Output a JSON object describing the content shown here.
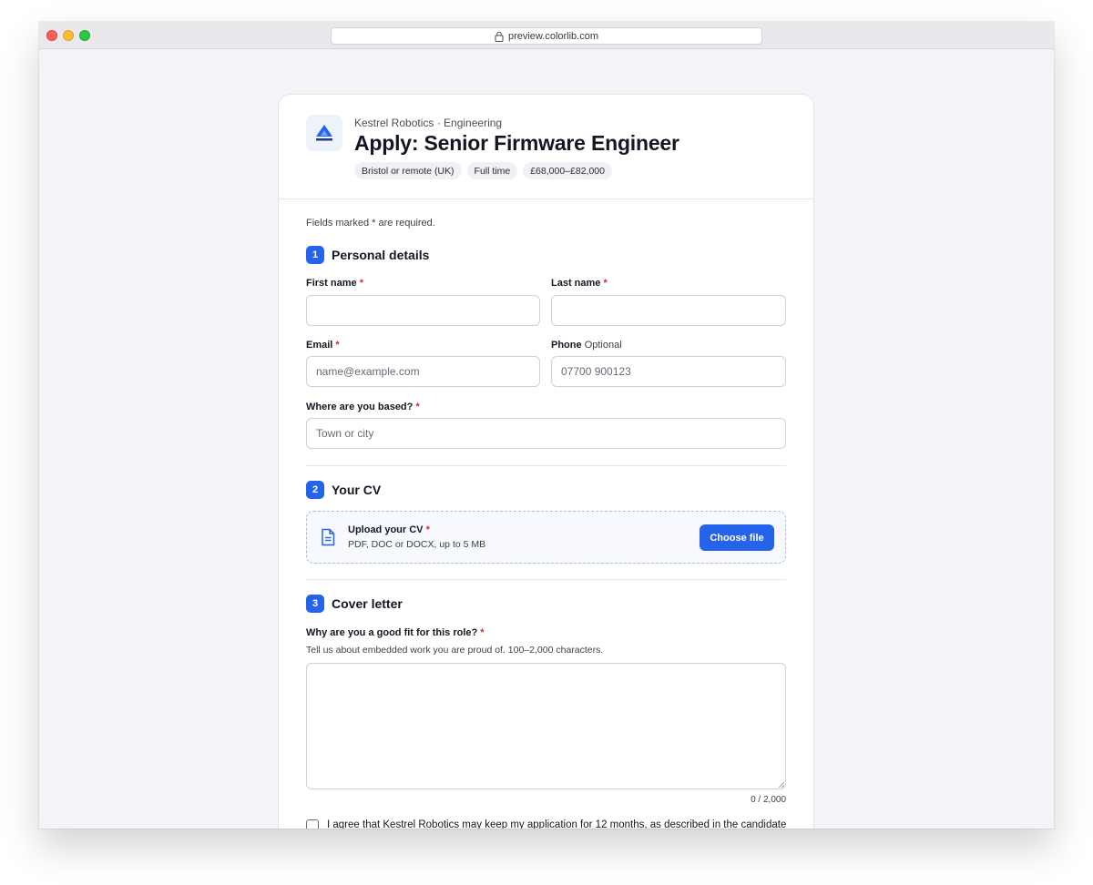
{
  "browser": {
    "url": "preview.colorlib.com"
  },
  "header": {
    "company": "Kestrel Robotics · Engineering",
    "title": "Apply: Senior Firmware Engineer",
    "tags": [
      "Bristol or remote (UK)",
      "Full time",
      "£68,000–£82,000"
    ]
  },
  "form": {
    "required_note": "Fields marked * are required.",
    "sections": [
      {
        "number": "1",
        "title": "Personal details"
      },
      {
        "number": "2",
        "title": "Your CV"
      },
      {
        "number": "3",
        "title": "Cover letter"
      }
    ],
    "first_name": {
      "label": "First name",
      "required_mark": "*",
      "value": ""
    },
    "last_name": {
      "label": "Last name",
      "required_mark": "*",
      "value": ""
    },
    "email": {
      "label": "Email",
      "required_mark": "*",
      "placeholder": "name@example.com"
    },
    "phone": {
      "label": "Phone",
      "optional": "Optional",
      "placeholder": "07700 900123"
    },
    "location": {
      "label": "Where are you based?",
      "required_mark": "*",
      "placeholder": "Town or city"
    },
    "cv": {
      "title": "Upload your CV",
      "required_mark": "*",
      "subtitle": "PDF, DOC or DOCX, up to 5 MB",
      "button": "Choose file",
      "icon": "file-icon"
    },
    "cover": {
      "label": "Why are you a good fit for this role?",
      "required_mark": "*",
      "hint": "Tell us about embedded work you are proud of. 100–2,000 characters.",
      "counter": "0 / 2,000"
    },
    "consent": "I agree that Kestrel Robotics may keep my application for 12 months, as described in the candidate"
  },
  "colors": {
    "accent": "#2563eb",
    "required": "#dc2626"
  }
}
